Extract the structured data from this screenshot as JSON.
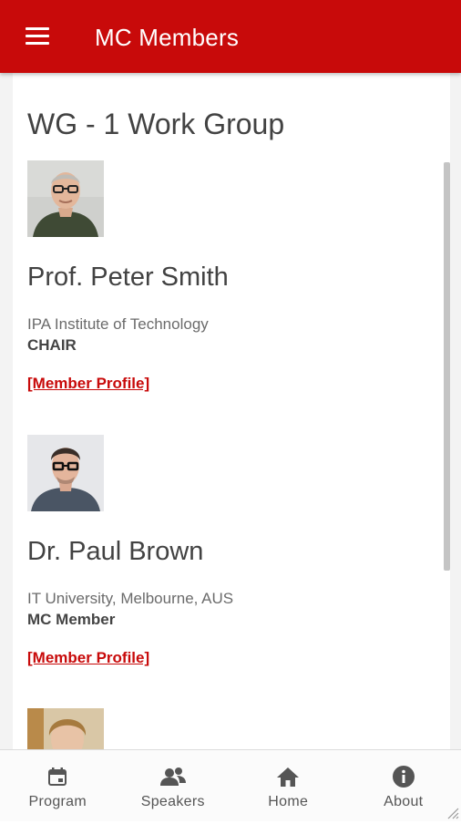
{
  "appbar": {
    "menu_icon": "hamburger-menu-icon",
    "title": "MC Members"
  },
  "group": {
    "title": "WG - 1 Work Group"
  },
  "members": [
    {
      "name": "Prof. Peter Smith",
      "affiliation": "IPA Institute of Technology",
      "role": "CHAIR",
      "profile_link": "[Member Profile]"
    },
    {
      "name": "Dr. Paul Brown",
      "affiliation": "IT University, Melbourne, AUS",
      "role": "MC Member",
      "profile_link": "[Member Profile]"
    }
  ],
  "bottom_nav": [
    {
      "label": "Program",
      "icon": "calendar-icon"
    },
    {
      "label": "Speakers",
      "icon": "speakers-icon"
    },
    {
      "label": "Home",
      "icon": "home-icon"
    },
    {
      "label": "About",
      "icon": "info-icon"
    }
  ],
  "colors": {
    "brand": "#c80a0a",
    "link": "#c80a0a",
    "text": "#424242"
  }
}
